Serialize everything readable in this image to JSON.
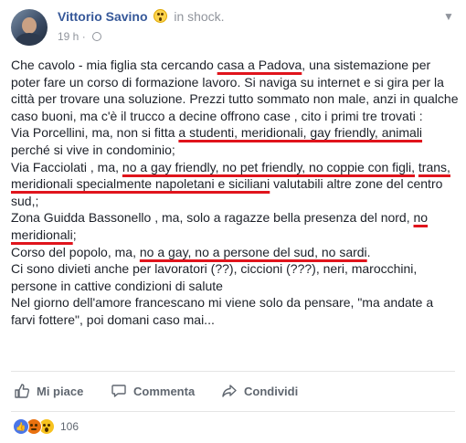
{
  "post": {
    "author": "Vittorio Savino",
    "feeling": "in shock.",
    "feeling_icon": "shocked-emoji-icon",
    "time": "19 h",
    "privacy_icon": "globe-icon",
    "options_icon": "chevron-down-icon",
    "text": {
      "p1": {
        "a": "Che cavolo - mia figlia sta cercando ",
        "m1": "casa a Padova",
        "b": ", una sistemazione per poter fare un corso di formazione lavoro. Si naviga su internet e si gira per la città per trovare una soluzione. Prezzi tutto sommato non male, anzi in qualche caso buoni, ma c'è il trucco a decine offrono case , cito i primi tre trovati :"
      },
      "p2": {
        "a": "Via Porcellini, ma, non si fitta ",
        "m1": "a studenti, meridionali, gay friendly, animali",
        "b": " perché si vive in condominio;"
      },
      "p3": {
        "a": "Via Facciolati , ma, ",
        "m1": "no a gay friendly, no pet friendly, no coppie con figli,",
        "b": " ",
        "m2": "trans, meridionali specialmente napoletani e siciliani",
        "c": " valutabili altre zone del centro sud,;"
      },
      "p4": {
        "a": "Zona Guidda Bassonello , ma, solo a ragazze bella presenza del nord, ",
        "m1": "no meridionali",
        "b": ";"
      },
      "p5": {
        "a": "Corso del popolo, ma, ",
        "m1": "no a gay, no a persone del sud, no sardi",
        "b": "."
      },
      "p6": "Ci sono divieti anche per lavoratori (??), ciccioni (???), neri, marocchini, persone in cattive condizioni di salute",
      "p7": "Nel giorno dell'amore francescano mi viene solo da pensare, \"ma andate a farvi fottere\", poi domani caso mai..."
    },
    "actions": {
      "like": "Mi piace",
      "comment": "Commenta",
      "share": "Condividi"
    },
    "reactions": {
      "icons": [
        "like-reaction-icon",
        "angry-reaction-icon",
        "wow-reaction-icon"
      ],
      "count": "106"
    }
  },
  "colors": {
    "author_link": "#365899",
    "highlight_underline": "#e0141c",
    "meta_gray": "#90949c",
    "action_gray": "#606770"
  }
}
